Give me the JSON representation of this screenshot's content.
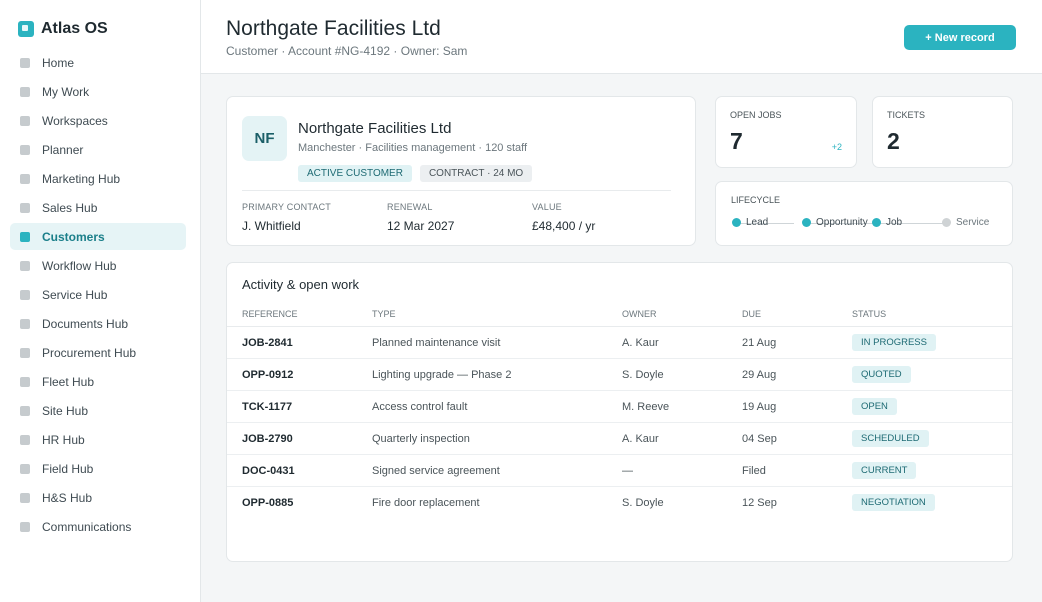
{
  "app": {
    "name": "Atlas OS"
  },
  "sidebar": {
    "items": [
      {
        "label": "Home",
        "active": false
      },
      {
        "label": "My Work",
        "active": false
      },
      {
        "label": "Workspaces",
        "active": false
      },
      {
        "label": "Planner",
        "active": false
      },
      {
        "label": "Marketing Hub",
        "active": false
      },
      {
        "label": "Sales Hub",
        "active": false
      },
      {
        "label": "Customers",
        "active": true
      },
      {
        "label": "Workflow Hub",
        "active": false
      },
      {
        "label": "Service Hub",
        "active": false
      },
      {
        "label": "Documents Hub",
        "active": false
      },
      {
        "label": "Procurement Hub",
        "active": false
      },
      {
        "label": "Fleet Hub",
        "active": false
      },
      {
        "label": "Site Hub",
        "active": false
      },
      {
        "label": "HR Hub",
        "active": false
      },
      {
        "label": "Field Hub",
        "active": false
      },
      {
        "label": "H&S Hub",
        "active": false
      },
      {
        "label": "Communications",
        "active": false
      }
    ]
  },
  "header": {
    "title": "Northgate Facilities Ltd",
    "subtitle": "Customer · Account #NG-4192 · Owner: Sam",
    "new_button": "+ New record"
  },
  "company": {
    "initials": "NF",
    "name": "Northgate Facilities Ltd",
    "meta": "Manchester · Facilities management · 120 staff",
    "tags": [
      "ACTIVE CUSTOMER",
      "CONTRACT · 24 MO"
    ],
    "primary_contact_label": "PRIMARY CONTACT",
    "primary_contact": "J. Whitfield",
    "renewal_label": "RENEWAL",
    "renewal": "12 Mar 2027",
    "value_label": "VALUE",
    "value": "£48,400 / yr"
  },
  "stats": {
    "open_jobs": {
      "label": "OPEN JOBS",
      "value": "7",
      "delta": "+2"
    },
    "tickets": {
      "label": "TICKETS",
      "value": "2"
    }
  },
  "lifecycle": {
    "label": "LIFECYCLE",
    "steps": [
      {
        "label": "Lead",
        "done": true
      },
      {
        "label": "Opportunity",
        "done": true
      },
      {
        "label": "Job",
        "done": true
      },
      {
        "label": "Service",
        "done": false
      }
    ]
  },
  "activity": {
    "title": "Activity & open work",
    "columns": [
      "REFERENCE",
      "TYPE",
      "OWNER",
      "DUE",
      "STATUS"
    ],
    "rows": [
      {
        "ref": "JOB-2841",
        "type": "Planned maintenance visit",
        "owner": "A. Kaur",
        "due": "21 Aug",
        "status": "IN PROGRESS"
      },
      {
        "ref": "OPP-0912",
        "type": "Lighting upgrade — Phase 2",
        "owner": "S. Doyle",
        "due": "29 Aug",
        "status": "QUOTED"
      },
      {
        "ref": "TCK-1177",
        "type": "Access control fault",
        "owner": "M. Reeve",
        "due": "19 Aug",
        "status": "OPEN"
      },
      {
        "ref": "JOB-2790",
        "type": "Quarterly inspection",
        "owner": "A. Kaur",
        "due": "04 Sep",
        "status": "SCHEDULED"
      },
      {
        "ref": "DOC-0431",
        "type": "Signed service agreement",
        "owner": "—",
        "due": "Filed",
        "status": "CURRENT"
      },
      {
        "ref": "OPP-0885",
        "type": "Fire door replacement",
        "owner": "S. Doyle",
        "due": "12 Sep",
        "status": "NEGOTIATION"
      }
    ]
  },
  "colors": {
    "accent": "#2bb3c0",
    "active_bg": "#e6f4f6",
    "badge_bg": "#e0f2f4"
  }
}
